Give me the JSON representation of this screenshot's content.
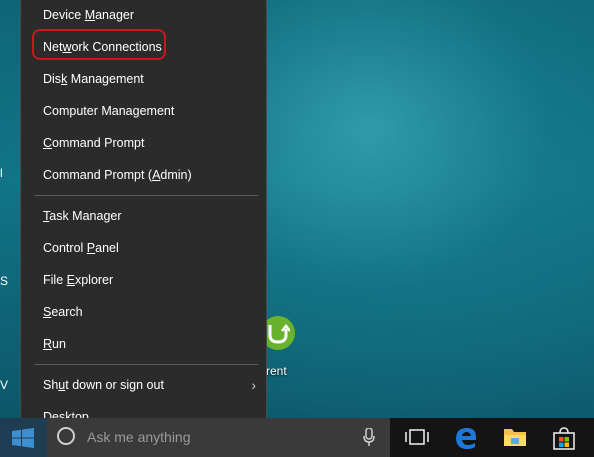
{
  "context_menu": {
    "items": [
      {
        "pre": "Device ",
        "key": "M",
        "post": "anager"
      },
      {
        "pre": "Net",
        "key": "w",
        "post": "ork Connections"
      },
      {
        "pre": "Dis",
        "key": "k",
        "post": " Management"
      },
      {
        "pre": "Computer Mana",
        "key": "g",
        "post": "ement"
      },
      {
        "pre": "",
        "key": "C",
        "post": "ommand Prompt"
      },
      {
        "pre": "Command Prompt (",
        "key": "A",
        "post": "dmin)"
      },
      {
        "pre": "",
        "key": "T",
        "post": "ask Manager"
      },
      {
        "pre": "Control ",
        "key": "P",
        "post": "anel"
      },
      {
        "pre": "File ",
        "key": "E",
        "post": "xplorer"
      },
      {
        "pre": "",
        "key": "S",
        "post": "earch"
      },
      {
        "pre": "",
        "key": "R",
        "post": "un"
      },
      {
        "pre": "Sh",
        "key": "u",
        "post": "t down or sign out"
      },
      {
        "pre": "",
        "key": "D",
        "post": "esktop"
      }
    ],
    "submenu_chevron": "›",
    "highlighted_item": "Network Connections"
  },
  "desktop": {
    "icon_label": "rent",
    "edge_chars": [
      "l",
      "S",
      "V"
    ]
  },
  "taskbar": {
    "search_placeholder": "Ask me anything"
  },
  "colors": {
    "menu_bg": "#2b2b2b",
    "highlight_border": "#d0141d",
    "taskbar_bg": "#141414",
    "edge_blue": "#1e78d7"
  }
}
